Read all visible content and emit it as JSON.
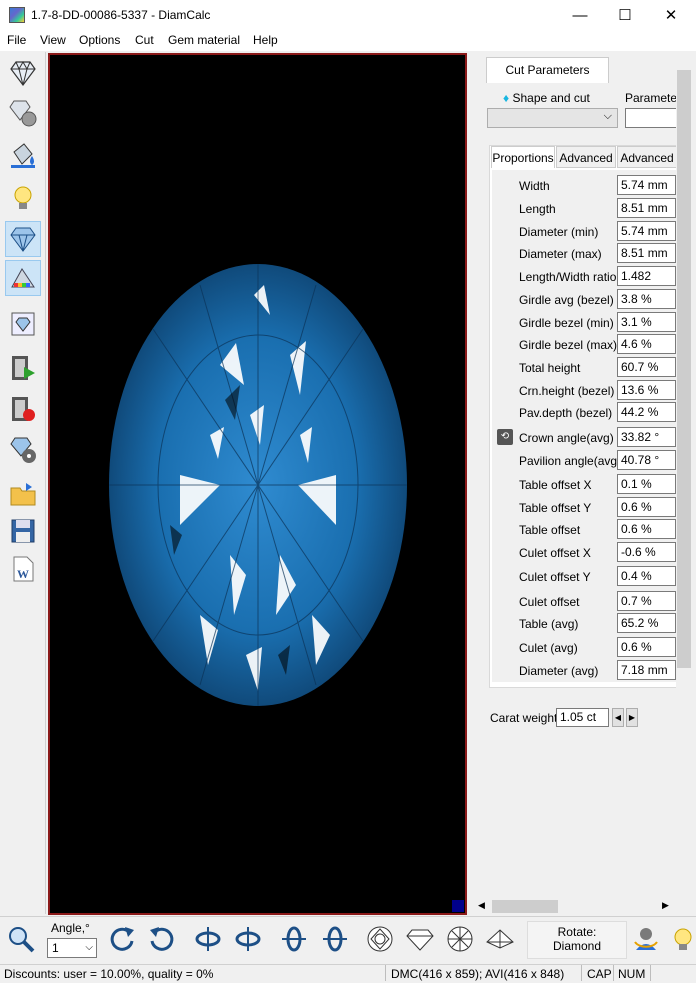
{
  "window": {
    "title": "1.7-8-DD-00086-5337 - DiamCalc",
    "minimize": "—",
    "maximize": "☐",
    "close": "✕"
  },
  "menu": [
    "File",
    "View",
    "Options",
    "Cut",
    "Gem material",
    "Help"
  ],
  "left_toolbar": [
    {
      "icon": "diamond-wireframe-icon",
      "active": false
    },
    {
      "icon": "diamond-sphere-icon",
      "active": false
    },
    {
      "icon": "paint-bucket-icon",
      "active": false
    },
    {
      "icon": "light-bulb-icon",
      "active": false
    },
    {
      "icon": "diamond-render-icon",
      "active": true
    },
    {
      "icon": "spectrum-icon",
      "active": true
    },
    {
      "icon": "diamond-photo-icon",
      "active": false
    },
    {
      "icon": "film-play-icon",
      "active": false
    },
    {
      "icon": "film-record-icon",
      "active": false
    },
    {
      "icon": "diamond-reel-icon",
      "active": false
    },
    {
      "icon": "open-folder-icon",
      "active": false
    },
    {
      "icon": "save-disk-icon",
      "active": false
    },
    {
      "icon": "word-export-icon",
      "active": false
    }
  ],
  "panel": {
    "tab": "Cut Parameters",
    "shape_label": "Shape and cut",
    "parameters_label": "Parameter",
    "shape_value": "",
    "subtabs": [
      "Proportions",
      "Advanced",
      "Advanced"
    ],
    "rows": [
      {
        "label": "Width",
        "value": "5.74 mm",
        "locked": false
      },
      {
        "label": "Length",
        "value": "8.51 mm",
        "locked": false
      },
      {
        "label": "Diameter (min)",
        "value": "5.74 mm",
        "locked": false
      },
      {
        "label": "Diameter (max)",
        "value": "8.51 mm",
        "locked": false
      },
      {
        "label": "Length/Width ratio",
        "value": "1.482",
        "locked": false
      },
      {
        "label": "Girdle avg (bezel)",
        "value": "3.8 %",
        "locked": false
      },
      {
        "label": "Girdle bezel (min)",
        "value": "3.1 %",
        "locked": false
      },
      {
        "label": "Girdle bezel (max)",
        "value": "4.6 %",
        "locked": false
      },
      {
        "label": "Total height",
        "value": "60.7 %",
        "locked": false
      },
      {
        "label": "Crn.height (bezel)",
        "value": "13.6 %",
        "locked": false
      },
      {
        "label": "Pav.depth (bezel)",
        "value": "44.2 %",
        "locked": false
      },
      {
        "label": "Crown angle(avg)",
        "value": "33.82 °",
        "locked": true
      },
      {
        "label": "Pavilion angle(avg)",
        "value": "40.78 °",
        "locked": false
      },
      {
        "label": "Table offset X",
        "value": "0.1 %",
        "locked": false
      },
      {
        "label": "Table offset Y",
        "value": "0.6 %",
        "locked": false
      },
      {
        "label": "Table offset",
        "value": "0.6 %",
        "locked": false
      },
      {
        "label": "Culet offset X",
        "value": "-0.6 %",
        "locked": false
      },
      {
        "label": "Culet offset Y",
        "value": "0.4 %",
        "locked": false
      },
      {
        "label": "Culet offset",
        "value": "0.7 %",
        "locked": false
      },
      {
        "label": "Table (avg)",
        "value": "65.2 %",
        "locked": false
      },
      {
        "label": "Culet (avg)",
        "value": "0.6 %",
        "locked": false
      },
      {
        "label": "Diameter (avg)",
        "value": "7.18 mm",
        "locked": false
      }
    ],
    "carat_label": "Carat weight",
    "carat_value": "1.05 ct"
  },
  "bottom_toolbar": {
    "angle_label": "Angle,°",
    "angle_value": "1",
    "rotate_title": "Rotate:",
    "rotate_value": "Diamond",
    "tools": [
      "zoom-icon",
      "rotate-cw-icon",
      "rotate-ccw-icon",
      "flip-vertical-left-icon",
      "flip-vertical-right-icon",
      "flip-horizontal-up-icon",
      "flip-horizontal-down-icon",
      "top-view-icon",
      "side-view-icon",
      "bottom-view-icon",
      "pavilion-view-icon",
      "user-rotate-icon",
      "light-icon"
    ]
  },
  "status": {
    "discounts": "Discounts: user = 10.00%, quality = 0%",
    "dmc": "DMC(416 x 859); AVI(416 x 848)",
    "cap": "CAP",
    "num": "NUM"
  },
  "colors": {
    "viewport_bg": "#000000",
    "viewport_border": "#8b1a1a",
    "gem_blue": "#1a6fb0",
    "accent_tool": "#cce4f7"
  }
}
